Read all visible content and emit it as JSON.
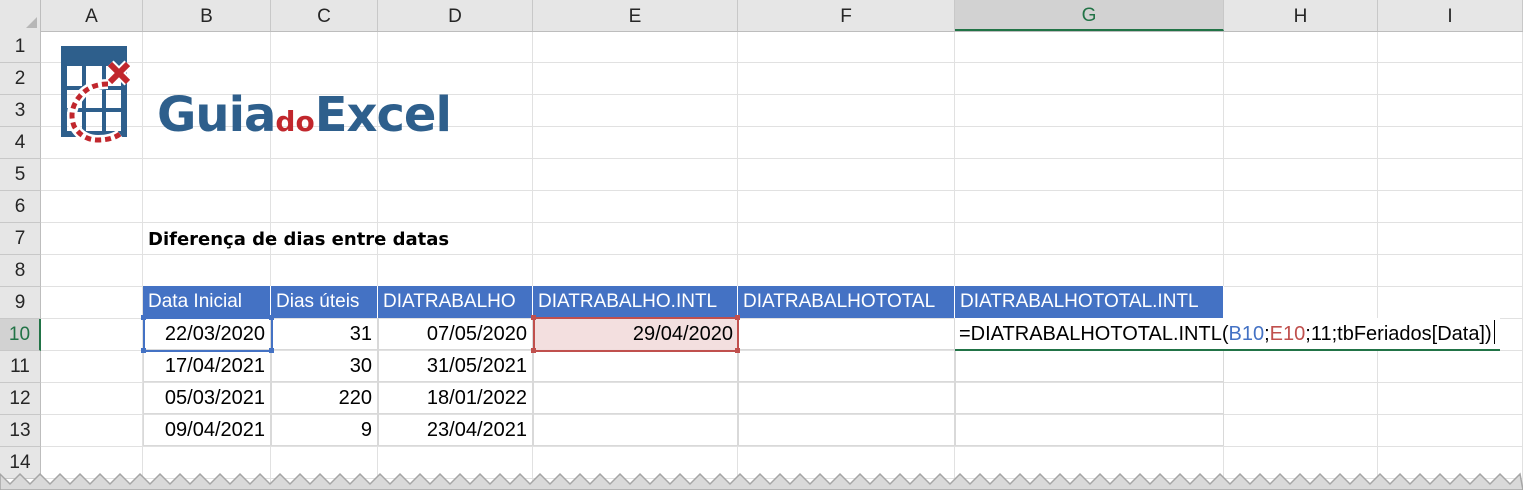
{
  "columns": [
    "A",
    "B",
    "C",
    "D",
    "E",
    "F",
    "G",
    "H",
    "I"
  ],
  "active_column": "G",
  "rows": [
    "1",
    "2",
    "3",
    "4",
    "5",
    "6",
    "7",
    "8",
    "9",
    "10",
    "11",
    "12",
    "13",
    "14"
  ],
  "active_row": "10",
  "logo": {
    "part1": "Guia",
    "part2": "do",
    "part3": "Excel",
    "icon": "map-grid-x-icon",
    "colors": {
      "blue": "#2e5f8c",
      "red": "#c1272d"
    }
  },
  "section_title": "Diferença de dias entre datas",
  "table": {
    "headers": [
      "Data Inicial",
      "Dias úteis",
      "DIATRABALHO",
      "DIATRABALHO.INTL",
      "DIATRABALHOTOTAL",
      "DIATRABALHOTOTAL.INTL"
    ],
    "rows": [
      [
        "22/03/2020",
        "31",
        "07/05/2020",
        "29/04/2020",
        "",
        ""
      ],
      [
        "17/04/2021",
        "30",
        "31/05/2021",
        "",
        "",
        ""
      ],
      [
        "05/03/2021",
        "220",
        "18/01/2022",
        "",
        "",
        ""
      ],
      [
        "09/04/2021",
        "9",
        "23/04/2021",
        "",
        "",
        ""
      ]
    ],
    "header_color": "#4472c4"
  },
  "editing_formula": {
    "prefix": "=DIATRABALHOTOTAL.INTL(",
    "ref1": "B10",
    "sep1": ";",
    "ref2": "E10",
    "suffix": ";11;tbFeriados[Data])",
    "ref1_color": "#4472c4",
    "ref2_color": "#c0504d"
  },
  "accent": "#217346"
}
